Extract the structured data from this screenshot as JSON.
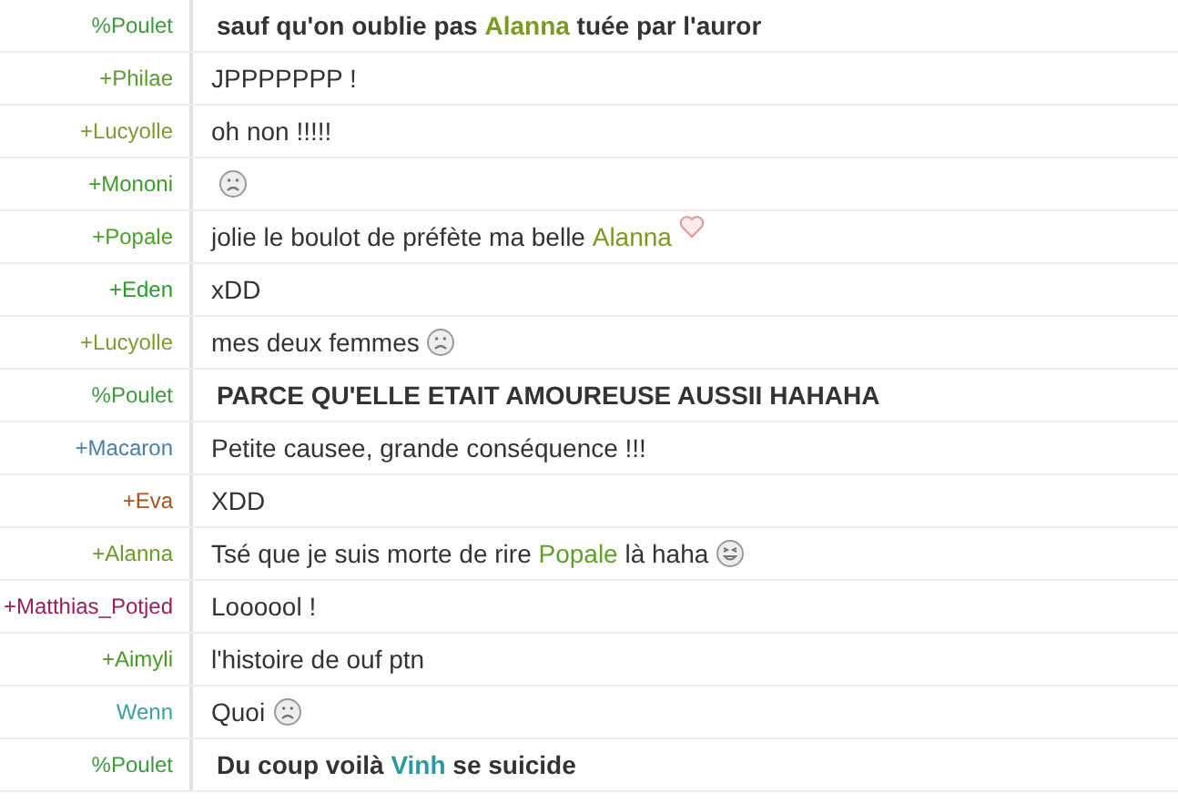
{
  "messages": [
    {
      "user": "%Poulet",
      "color": "#3f9a3f",
      "bold": true,
      "parts": [
        {
          "kind": "text",
          "text": "sauf qu'on oublie pas "
        },
        {
          "kind": "mention",
          "text": "Alanna",
          "color": "#7a9a22"
        },
        {
          "kind": "text",
          "text": " tuée par l'auror"
        }
      ]
    },
    {
      "user": "+Philae",
      "color": "#5b9a32",
      "bold": false,
      "parts": [
        {
          "kind": "text",
          "text": "JPPPPPPP !"
        }
      ]
    },
    {
      "user": "+Lucyolle",
      "color": "#7f9a35",
      "bold": false,
      "parts": [
        {
          "kind": "text",
          "text": "oh non !!!!!"
        }
      ]
    },
    {
      "user": "+Mononi",
      "color": "#3f9a2a",
      "bold": false,
      "parts": [
        {
          "kind": "sad_face"
        }
      ]
    },
    {
      "user": "+Popale",
      "color": "#4aa02a",
      "bold": false,
      "parts": [
        {
          "kind": "text",
          "text": "jolie le boulot de préfète ma belle "
        },
        {
          "kind": "mention",
          "text": "Alanna",
          "color": "#7a9a22"
        },
        {
          "kind": "heart"
        }
      ]
    },
    {
      "user": "+Eden",
      "color": "#2a9a2a",
      "bold": false,
      "parts": [
        {
          "kind": "text",
          "text": "xDD"
        }
      ]
    },
    {
      "user": "+Lucyolle",
      "color": "#7f9a35",
      "bold": false,
      "parts": [
        {
          "kind": "text",
          "text": "mes deux femmes"
        },
        {
          "kind": "sad_face"
        }
      ]
    },
    {
      "user": "%Poulet",
      "color": "#3f9a3f",
      "bold": true,
      "parts": [
        {
          "kind": "text",
          "text": "PARCE QU'ELLE ETAIT AMOUREUSE AUSSII HAHAHA"
        }
      ]
    },
    {
      "user": "+Macaron",
      "color": "#4a7fa0",
      "bold": false,
      "parts": [
        {
          "kind": "text",
          "text": "Petite causee, grande conséquence !!!"
        }
      ]
    },
    {
      "user": "+Eva",
      "color": "#a8521f",
      "bold": false,
      "parts": [
        {
          "kind": "text",
          "text": "XDD"
        }
      ]
    },
    {
      "user": "+Alanna",
      "color": "#6a9a2a",
      "bold": false,
      "parts": [
        {
          "kind": "text",
          "text": "Tsé que je suis morte de rire "
        },
        {
          "kind": "mention",
          "text": "Popale",
          "color": "#5fa02a"
        },
        {
          "kind": "text",
          "text": " là haha"
        },
        {
          "kind": "laughing_face"
        }
      ]
    },
    {
      "user": "+Matthias_Potjed",
      "color": "#952060",
      "bold": false,
      "parts": [
        {
          "kind": "text",
          "text": "Loooool !"
        }
      ]
    },
    {
      "user": "+Aimyli",
      "color": "#4a9a2a",
      "bold": false,
      "parts": [
        {
          "kind": "text",
          "text": "l'histoire de ouf ptn"
        }
      ]
    },
    {
      "user": "Wenn",
      "color": "#3aa0a0",
      "bold": false,
      "parts": [
        {
          "kind": "text",
          "text": "Quoi"
        },
        {
          "kind": "sad_face"
        }
      ]
    },
    {
      "user": "%Poulet",
      "color": "#3f9a3f",
      "bold": true,
      "parts": [
        {
          "kind": "text",
          "text": "Du coup voilà "
        },
        {
          "kind": "mention",
          "text": "Vinh",
          "color": "#2a9aa0"
        },
        {
          "kind": "text",
          "text": " se suicide"
        }
      ]
    }
  ]
}
